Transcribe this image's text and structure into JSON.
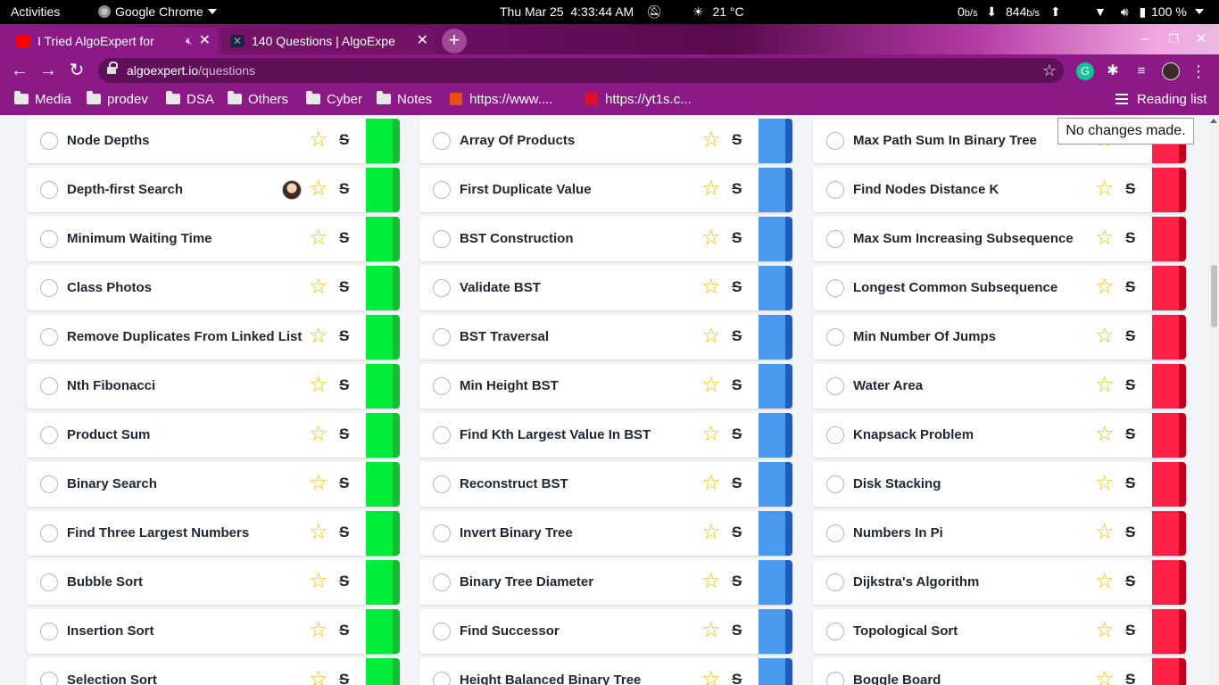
{
  "system_bar": {
    "activities": "Activities",
    "app_name": "Google Chrome",
    "date": "Thu Mar 25",
    "time": "4:33:44 AM",
    "weather": "21 °C",
    "net_up_value": "0",
    "net_up_unit": "b/s",
    "net_down_value": "844",
    "net_down_unit": "b/s",
    "battery": "100 %"
  },
  "tabs": [
    {
      "title": "I Tried AlgoExpert for",
      "favicon": "youtube-icon",
      "muted": true
    },
    {
      "title": "140 Questions | AlgoExpe",
      "favicon": "algoexpert-icon"
    }
  ],
  "address_bar": {
    "domain": "algoexpert.io",
    "path": "/questions"
  },
  "bookmarks": {
    "items": [
      {
        "label": "Media",
        "type": "folder"
      },
      {
        "label": "prodev",
        "type": "folder"
      },
      {
        "label": "DSA",
        "type": "folder"
      },
      {
        "label": "Others",
        "type": "folder"
      },
      {
        "label": "Cyber",
        "type": "folder"
      },
      {
        "label": "Notes",
        "type": "folder"
      },
      {
        "label": "https://www....",
        "type": "link"
      },
      {
        "label": "https://yt1s.c...",
        "type": "link"
      }
    ],
    "reading_list": "Reading list"
  },
  "tooltip": "No changes made.",
  "colors": {
    "easy": "#00ee3a",
    "easy_dark": "#10c030",
    "medium": "#4a9bf0",
    "medium_dark": "#1a5fc0",
    "hard": "#ff2147",
    "hard_dark": "#c5001c",
    "star": "#f3c200"
  },
  "columns": [
    {
      "difficulty": "easy",
      "questions": [
        {
          "name": "Node Depths"
        },
        {
          "name": "Depth-first Search",
          "has_avatar": true
        },
        {
          "name": "Minimum Waiting Time"
        },
        {
          "name": "Class Photos"
        },
        {
          "name": "Remove Duplicates From Linked List"
        },
        {
          "name": "Nth Fibonacci"
        },
        {
          "name": "Product Sum"
        },
        {
          "name": "Binary Search"
        },
        {
          "name": "Find Three Largest Numbers"
        },
        {
          "name": "Bubble Sort"
        },
        {
          "name": "Insertion Sort"
        },
        {
          "name": "Selection Sort"
        }
      ]
    },
    {
      "difficulty": "medium",
      "questions": [
        {
          "name": "Array Of Products"
        },
        {
          "name": "First Duplicate Value"
        },
        {
          "name": "BST Construction"
        },
        {
          "name": "Validate BST"
        },
        {
          "name": "BST Traversal"
        },
        {
          "name": "Min Height BST"
        },
        {
          "name": "Find Kth Largest Value In BST"
        },
        {
          "name": "Reconstruct BST"
        },
        {
          "name": "Invert Binary Tree"
        },
        {
          "name": "Binary Tree Diameter"
        },
        {
          "name": "Find Successor"
        },
        {
          "name": "Height Balanced Binary Tree"
        }
      ]
    },
    {
      "difficulty": "hard",
      "questions": [
        {
          "name": "Max Path Sum In Binary Tree"
        },
        {
          "name": "Find Nodes Distance K"
        },
        {
          "name": "Max Sum Increasing Subsequence"
        },
        {
          "name": "Longest Common Subsequence"
        },
        {
          "name": "Min Number Of Jumps"
        },
        {
          "name": "Water Area"
        },
        {
          "name": "Knapsack Problem"
        },
        {
          "name": "Disk Stacking"
        },
        {
          "name": "Numbers In Pi"
        },
        {
          "name": "Dijkstra's Algorithm"
        },
        {
          "name": "Topological Sort"
        },
        {
          "name": "Boggle Board"
        }
      ]
    }
  ]
}
